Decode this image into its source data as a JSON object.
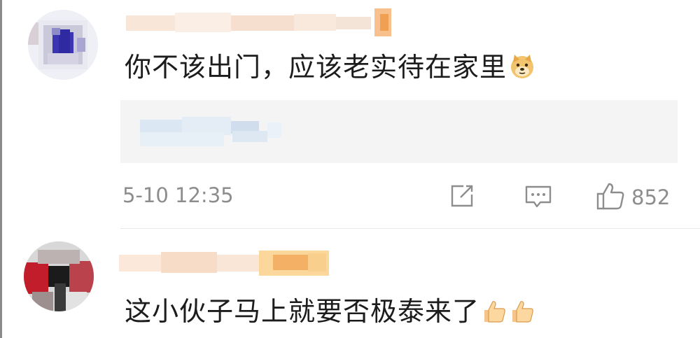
{
  "comments": [
    {
      "text": "你不该出门，应该老实待在家里",
      "emoji": "doge-emoji",
      "timestamp": "5-10 12:35",
      "like_count": "852"
    },
    {
      "text": "这小伙子马上就要否极泰来了",
      "emoji": "thumbs-up-emoji"
    }
  ],
  "colors": {
    "text": "#1c1c1c",
    "meta": "#8d8d8d",
    "quote_bg": "#f4f4f4",
    "divider": "#e8e8e8"
  }
}
